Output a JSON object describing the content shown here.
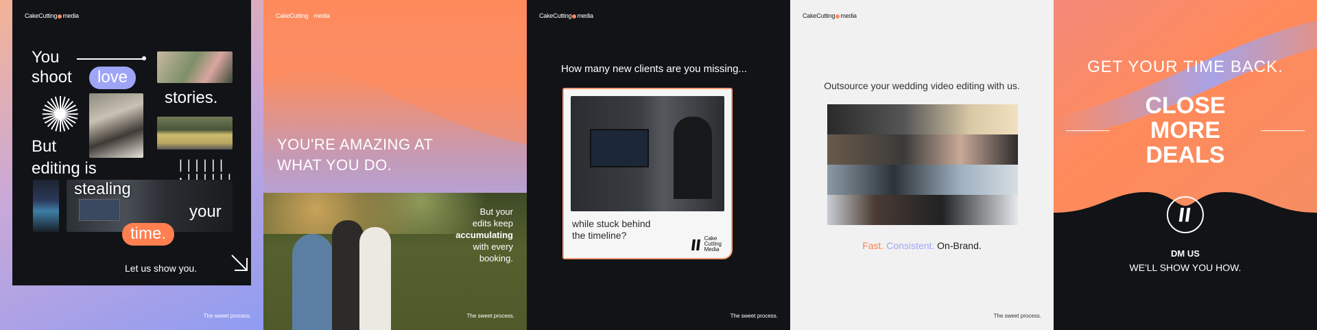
{
  "brand": {
    "logo_text_1": "CakeCutting",
    "logo_text_2": "media",
    "footer": "The sweet process."
  },
  "slide1": {
    "w_you": "You",
    "w_shoot": "shoot",
    "w_love": "love",
    "w_stories": "stories.",
    "w_but": "But",
    "w_editing": "editing is",
    "w_stealing": "stealing",
    "w_your": "your",
    "w_time": "time.",
    "ticks": "||||||·||||||",
    "cta": "Let us show you.",
    "colors": {
      "love_pill": "#9ea5f6",
      "time_pill": "#ff7f4f"
    }
  },
  "slide2": {
    "headline_1": "YOU'RE AMAZING AT",
    "headline_2": "WHAT YOU DO.",
    "cap_1": "But your",
    "cap_2": "edits keep",
    "cap_3": "accumulating",
    "cap_4": "with every",
    "cap_5": "booking."
  },
  "slide3": {
    "question": "How many new clients are you missing...",
    "note_1": "while stuck behind",
    "note_2": "the timeline?",
    "brand_1": "Cake",
    "brand_2": "Cutting",
    "brand_3": "Media"
  },
  "slide4": {
    "title": "Outsource your wedding video editing with us.",
    "tag_fast": "Fast.",
    "tag_consistent": "Consistent.",
    "tag_onbrand": "On-Brand.",
    "colors": {
      "fast": "#ff7f4f",
      "consistent": "#9ea5f6",
      "onbrand": "#222222"
    }
  },
  "slide5": {
    "headline": "GET YOUR TIME BACK.",
    "big_1": "CLOSE",
    "big_2": "MORE",
    "big_3": "DEALS",
    "cta_1": "DM US",
    "cta_2": "WE'LL SHOW YOU HOW."
  }
}
